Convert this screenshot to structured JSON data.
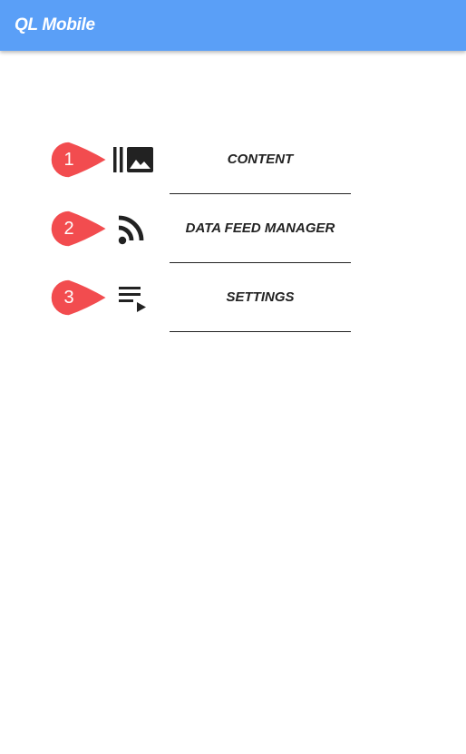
{
  "app": {
    "title": "QL Mobile"
  },
  "menu": {
    "items": [
      {
        "number": "1",
        "label": "CONTENT",
        "icon": "photo-library-icon"
      },
      {
        "number": "2",
        "label": "DATA FEED MANAGER",
        "icon": "rss-feed-icon"
      },
      {
        "number": "3",
        "label": "SETTINGS",
        "icon": "playlist-play-icon"
      }
    ]
  },
  "colors": {
    "app_bar": "#5a9ff7",
    "callout": "#f24c4f",
    "text": "#222222",
    "background": "#ffffff"
  }
}
